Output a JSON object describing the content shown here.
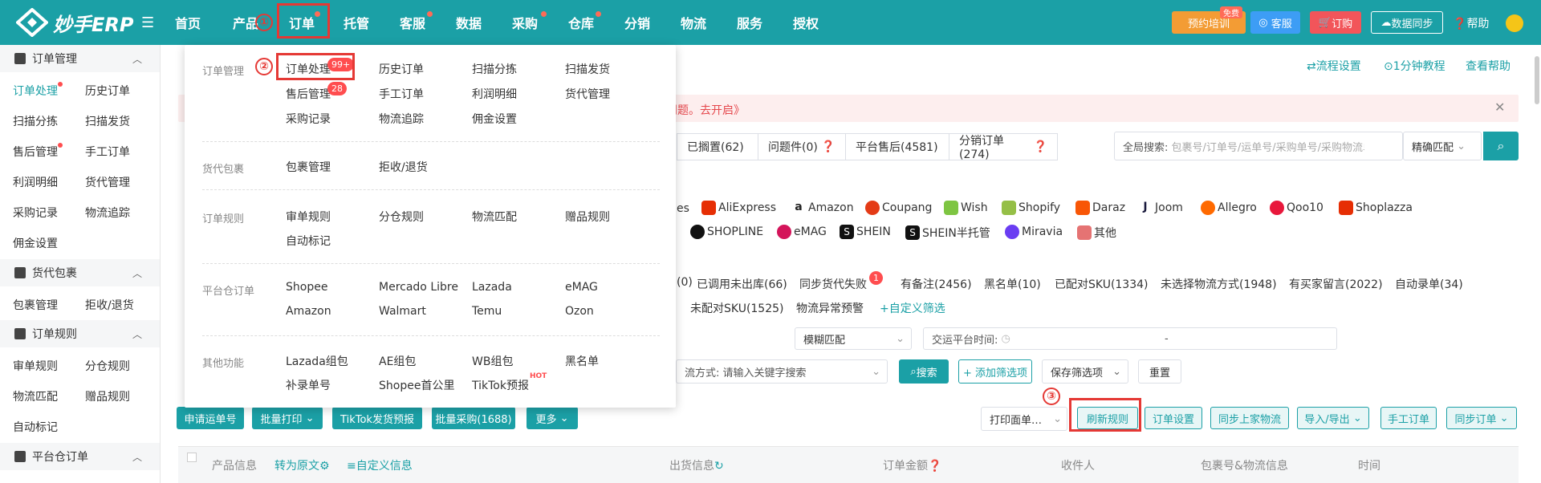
{
  "app": {
    "logo_text": "妙手ERP",
    "nav": [
      "首页",
      "产品",
      "订单",
      "托管",
      "客服",
      "数据",
      "采购",
      "仓库",
      "分销",
      "物流",
      "服务",
      "授权"
    ]
  },
  "topright": {
    "training": "预约培训",
    "free_tag": "免费",
    "service": "客服",
    "order": "订购",
    "sync": "数据同步",
    "help": "帮助"
  },
  "markers": {
    "m1": "①",
    "m2": "②",
    "m3": "③"
  },
  "sidebar": {
    "groups": [
      {
        "title": "订单管理",
        "items": [
          "订单处理",
          "历史订单",
          "扫描分拣",
          "扫描发货",
          "售后管理",
          "手工订单",
          "利润明细",
          "货代管理",
          "采购记录",
          "物流追踪",
          "佣金设置"
        ]
      },
      {
        "title": "货代包裹",
        "items": [
          "包裹管理",
          "拒收/退货"
        ]
      },
      {
        "title": "订单规则",
        "items": [
          "审单规则",
          "分仓规则",
          "物流匹配",
          "赠品规则",
          "自动标记"
        ]
      },
      {
        "title": "平台仓订单",
        "items": []
      }
    ]
  },
  "menu": {
    "groups": [
      {
        "label": "订单管理",
        "items": [
          "订单处理",
          "历史订单",
          "扫描分拣",
          "扫描发货",
          "售后管理",
          "手工订单",
          "利润明细",
          "货代管理",
          "采购记录",
          "物流追踪",
          "佣金设置"
        ]
      },
      {
        "label": "货代包裹",
        "items": [
          "包裹管理",
          "拒收/退货"
        ]
      },
      {
        "label": "订单规则",
        "items": [
          "审单规则",
          "分仓规则",
          "物流匹配",
          "赠品规则",
          "自动标记"
        ]
      },
      {
        "label": "平台仓订单",
        "items": [
          "Shopee",
          "Mercado Libre",
          "Lazada",
          "eMAG",
          "Amazon",
          "Walmart",
          "Temu",
          "Ozon"
        ]
      },
      {
        "label": "其他功能",
        "items": [
          "Lazada组包",
          "AE组包",
          "WB组包",
          "黑名单",
          "补录单号",
          "Shopee首公里",
          "TikTok预报"
        ]
      }
    ],
    "badge_orders": "99+",
    "badge_aftersale": "28",
    "hot": "HOT"
  },
  "header_links": {
    "flow": "流程设置",
    "tutorial": "1分钟教程",
    "help": "查看帮助"
  },
  "alert": {
    "text": "问题。",
    "link": "去开启》"
  },
  "tabs": [
    "已搁置(62)",
    "问题件(0)",
    "平台售后(4581)",
    "分销订单(274)"
  ],
  "search": {
    "label": "全局搜索:",
    "placeholder": "包裹号/订单号/运单号/采购单号/采购物流单号",
    "match": "精确匹配"
  },
  "platforms_row1": [
    "es",
    "AliExpress",
    "Amazon",
    "Coupang",
    "Wish",
    "Shopify",
    "Daraz",
    "Joom",
    "Allegro",
    "Qoo10",
    "Shoplazza"
  ],
  "platforms_row2": [
    "SHOPLINE",
    "eMAG",
    "SHEIN",
    "SHEIN半托管",
    "Miravia",
    "其他"
  ],
  "platform_colors": [
    "#ffffff",
    "#e62e04",
    "#222222",
    "#e43b16",
    "#7ec542",
    "#95bf47",
    "#f85606",
    "#1a1a3d",
    "#ff6a00",
    "#e8173b",
    "#e62e04",
    "#111111",
    "#d4145a",
    "#111111",
    "#111111",
    "#6a3df2",
    "#e57373"
  ],
  "filters_row1": [
    "(0)",
    "已调用未出库(66)",
    "同步货代失败",
    "有备注(2456)",
    "黑名单(10)",
    "已配对SKU(1334)",
    "未选择物流方式(1948)",
    "有买家留言(2022)",
    "自动录单(34)"
  ],
  "filters_row2": [
    "未配对SKU(1525)",
    "物流异常预警",
    "+自定义筛选"
  ],
  "sync_fail_badge": "1",
  "fuzzy": "模糊匹配",
  "trade_time_label": "交运平台时间:",
  "date_sep": "-",
  "logistics_label": "流方式:",
  "logistics_placeholder": "请输入关键字搜索",
  "search_btn": "搜索",
  "add_filter": "+ 添加筛选项",
  "save_filter": "保存筛选项",
  "reset": "重置",
  "actions_left": [
    "申请运单号",
    "批量打印",
    "TikTok发货预报",
    "批量采购(1688)",
    "更多"
  ],
  "print_face": "打印面单…",
  "actions_right": [
    "刷新规则",
    "订单设置",
    "同步上家物流",
    "导入/导出",
    "手工订单",
    "同步订单"
  ],
  "table_headers": [
    "产品信息",
    "转为原文",
    "≡自定义信息",
    "出货信息",
    "订单金额",
    "收件人",
    "包裹号&物流信息",
    "时间"
  ]
}
